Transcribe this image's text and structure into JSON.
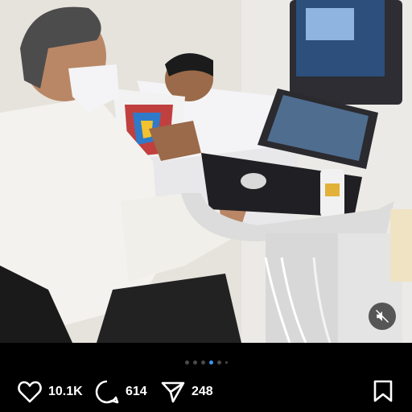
{
  "photo": {
    "description_icon": "photo-content"
  },
  "mute_button": {
    "icon": "muted-speaker-icon"
  },
  "carousel": {
    "total_dots": 6,
    "active_index": 3
  },
  "actions": {
    "likes": "10.1K",
    "comments": "614",
    "shares": "248"
  },
  "colors": {
    "background": "#000000",
    "active_dot": "#3897f0",
    "icon": "#ffffff"
  }
}
